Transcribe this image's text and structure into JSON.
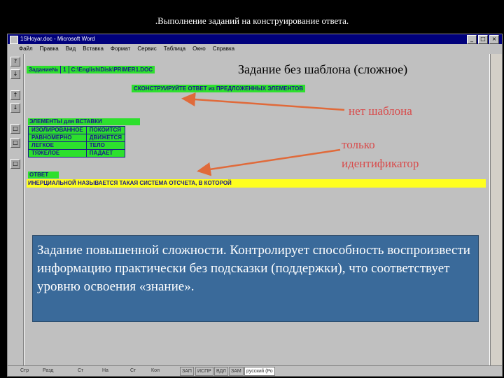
{
  "slide_title": ".Выполнение заданий на конструирование ответа.",
  "window": {
    "title": "1SHoyar.doc - Microsoft Word",
    "min_glyph": "_",
    "max_glyph": "□",
    "close_glyph": "×"
  },
  "menu": [
    "Файл",
    "Правка",
    "Вид",
    "Вставка",
    "Формат",
    "Сервис",
    "Таблица",
    "Окно",
    "Справка"
  ],
  "left_toolbar": [
    "?",
    "↓",
    "↑",
    "↓",
    "□",
    "□",
    "□"
  ],
  "document": {
    "header_cells": [
      "Задание№",
      "1",
      "C:\\English\\Disk\\PRIMER1.DOC"
    ],
    "task_label": "Задание без шаблона (сложное)",
    "instruction": "СКОНСТРУИРУЙТЕ ОТВЕТ из ПРЕДЛОЖЕННЫХ ЭЛЕМЕНТОВ",
    "no_template_label": "нет шаблона",
    "identifier_line1": "только",
    "identifier_line2": "идентификатор",
    "elements_title": "ЭЛЕМЕНТЫ для ВСТАВКИ",
    "elements": [
      [
        "ИЗОЛИРОВАННОЕ",
        "ПОКОИТСЯ"
      ],
      [
        "РАВНОМЕРНО",
        "ДВИЖЕТСЯ"
      ],
      [
        "ЛЕГКОЕ",
        "ТЕЛО"
      ],
      [
        "ТЯЖЕЛОЕ",
        "ПАДАЕТ"
      ]
    ],
    "answer_label": "ОТВЕТ",
    "answer_text": "ИНЕРЦИАЛЬНОЙ НАЗЫВАЕТСЯ ТАКАЯ СИСТЕМА ОТСЧЕТА, В КОТОРОЙ"
  },
  "info_box": "Задание повышенной сложности. Контролирует способность воспроизвести информацию практически без подсказки (поддержки), что соответствует уровню освоения «знание».",
  "statusbar": [
    "Стр",
    "Разд",
    "Ст",
    "На",
    "Ст",
    "Кол",
    "ЗАП",
    "ИСПР",
    "ВДЛ",
    "ЗАМ",
    "русский (Ро"
  ],
  "colors": {
    "highlight_green": "#2de02d",
    "highlight_yellow": "#ffff1e",
    "arrow_orange": "#e06a3a",
    "info_box_blue": "#3a6a9a",
    "titlebar_navy": "#00007b"
  }
}
